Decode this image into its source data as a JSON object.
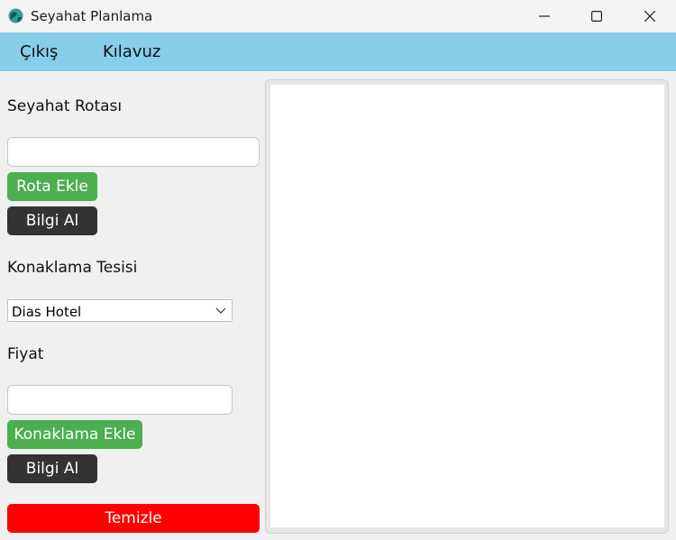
{
  "window": {
    "title": "Seyahat Planlama",
    "icon": "globe-icon",
    "controls": [
      "minimize-icon",
      "maximize-icon",
      "close-icon"
    ]
  },
  "menu": {
    "background": "#87ceeb",
    "items": [
      {
        "label": "Çıkış"
      },
      {
        "label": "Kılavuz"
      }
    ]
  },
  "route": {
    "label": "Seyahat Rotası",
    "input_value": "",
    "add_button": "Rota Ekle",
    "info_button": "Bilgi Al"
  },
  "accommodation": {
    "label": "Konaklama Tesisi",
    "selected": "Dias Hotel"
  },
  "price": {
    "label": "Fiyat",
    "input_value": "",
    "add_button": "Konaklama Ekle",
    "info_button": "Bilgi Al"
  },
  "clear_button": "Temizle",
  "colors": {
    "add_button": "#4caf50",
    "info_button": "#333333",
    "clear_button": "#ff0000"
  },
  "output": {
    "text": ""
  }
}
